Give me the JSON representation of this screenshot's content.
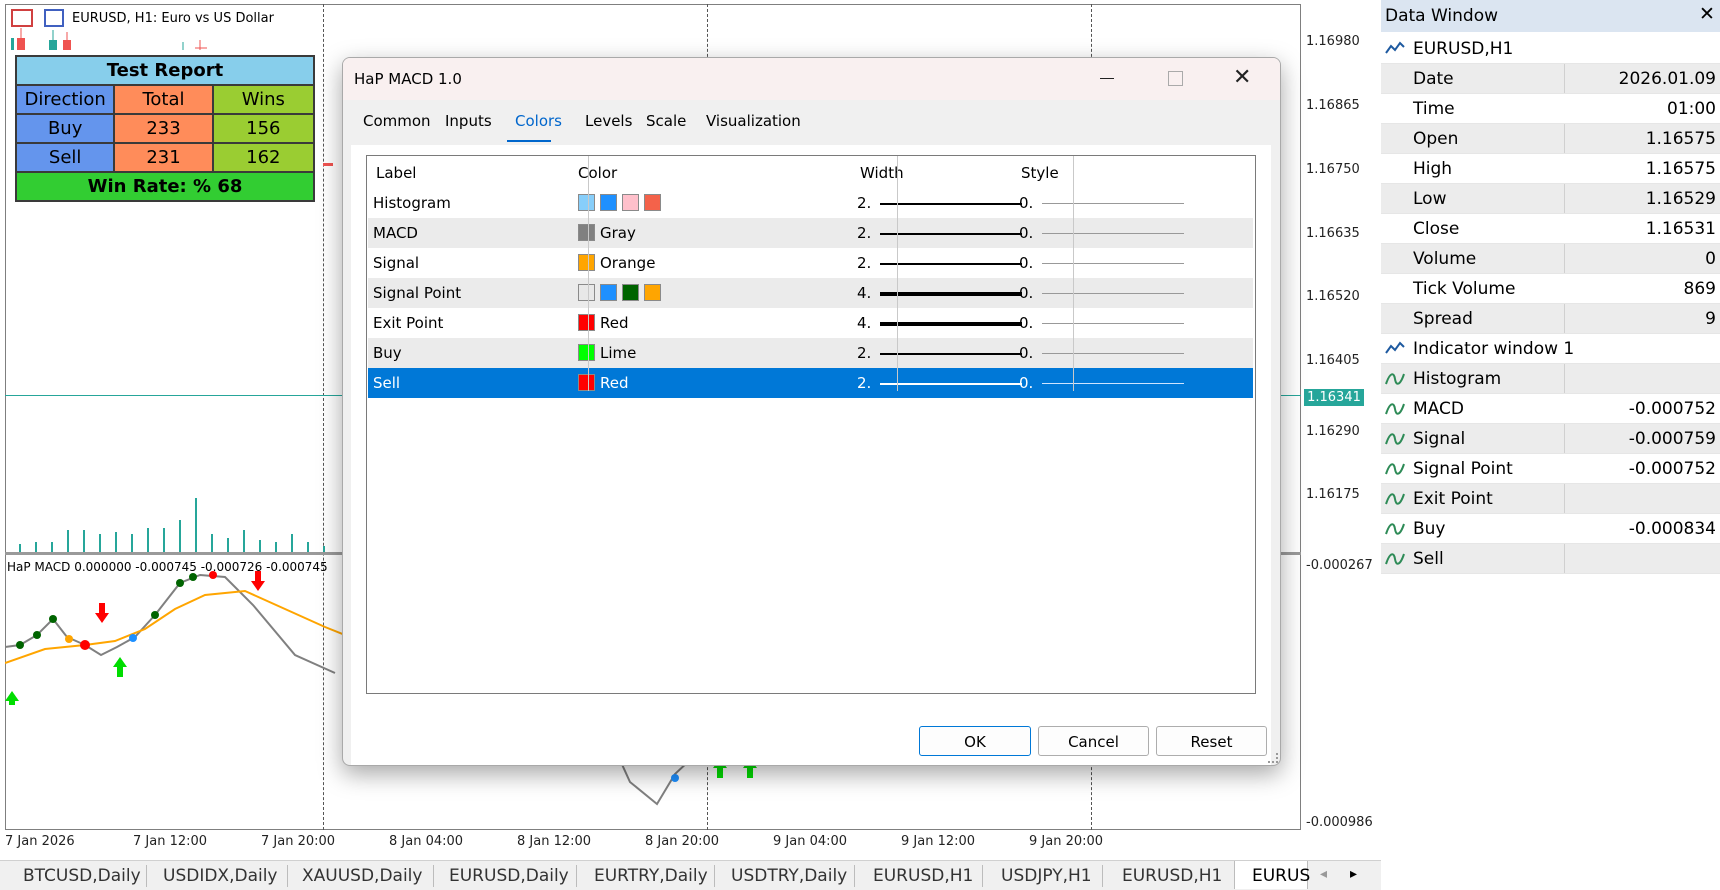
{
  "chart": {
    "title": "EURUSD, H1:  Euro vs US Dollar",
    "indicator_title": "HaP MACD 0.000000 -0.000745 -0.000726 -0.000745",
    "price_labels": [
      "1.16980",
      "1.16865",
      "1.16750",
      "1.16635",
      "1.16520",
      "1.16405",
      "1.16290",
      "1.16175",
      "-0.000267",
      "-0.000986"
    ],
    "current_price": "1.16341",
    "time_labels": [
      "7 Jan 2026",
      "7 Jan 12:00",
      "7 Jan 20:00",
      "8 Jan 04:00",
      "8 Jan 12:00",
      "8 Jan 20:00",
      "9 Jan 04:00",
      "9 Jan 12:00",
      "9 Jan 20:00"
    ],
    "colors": {
      "macd": "#808080",
      "signal": "#ffa500",
      "current_line": "#26a69a",
      "bull": "#26a69a",
      "bear": "#ef5350"
    }
  },
  "test_report": {
    "title": "Test Report",
    "headers": [
      "Direction",
      "Total",
      "Wins"
    ],
    "rows": [
      {
        "direction": "Buy",
        "total": "233",
        "wins": "156"
      },
      {
        "direction": "Sell",
        "total": "231",
        "wins": "162"
      }
    ],
    "win_rate_label": "Win Rate: %  68"
  },
  "dialog": {
    "title": "HaP MACD 1.0",
    "tabs": [
      "Common",
      "Inputs",
      "Colors",
      "Levels",
      "Scale",
      "Visualization"
    ],
    "active_tab": "Colors",
    "columns": [
      "Label",
      "Color",
      "Width",
      "Style"
    ],
    "rows": [
      {
        "label": "Histogram",
        "swatches": [
          "#87cefa",
          "#1e90ff",
          "#ffc0cb",
          "#f4624a"
        ],
        "color_name": "",
        "width": "2.",
        "style": "0."
      },
      {
        "label": "MACD",
        "swatches": [
          "#808080"
        ],
        "color_name": "Gray",
        "width": "2.",
        "style": "0."
      },
      {
        "label": "Signal",
        "swatches": [
          "#ffa500"
        ],
        "color_name": "Orange",
        "width": "2.",
        "style": "0."
      },
      {
        "label": "Signal Point",
        "swatches": [
          "#e8e8e8",
          "#1e90ff",
          "#006400",
          "#ffa500"
        ],
        "color_name": "",
        "width": "4.",
        "style": "0."
      },
      {
        "label": "Exit Point",
        "swatches": [
          "#ff0000"
        ],
        "color_name": "Red",
        "width": "4.",
        "style": "0."
      },
      {
        "label": "Buy",
        "swatches": [
          "#00ff00"
        ],
        "color_name": "Lime",
        "width": "2.",
        "style": "0."
      },
      {
        "label": "Sell",
        "swatches": [
          "#ff0000"
        ],
        "color_name": "Red",
        "width": "2.",
        "style": "0."
      }
    ],
    "selected_row": "Sell",
    "buttons": {
      "ok": "OK",
      "cancel": "Cancel",
      "reset": "Reset"
    }
  },
  "data_window": {
    "title": "Data Window",
    "symbol": "EURUSD,H1",
    "fields": [
      {
        "label": "Date",
        "value": "2026.01.09"
      },
      {
        "label": "Time",
        "value": "01:00"
      },
      {
        "label": "Open",
        "value": "1.16575"
      },
      {
        "label": "High",
        "value": "1.16575"
      },
      {
        "label": "Low",
        "value": "1.16529"
      },
      {
        "label": "Close",
        "value": "1.16531"
      },
      {
        "label": "Volume",
        "value": "0"
      },
      {
        "label": "Tick Volume",
        "value": "869"
      },
      {
        "label": "Spread",
        "value": "9"
      }
    ],
    "indicator_window": "Indicator window 1",
    "indicator_fields": [
      {
        "label": "Histogram",
        "value": ""
      },
      {
        "label": "MACD",
        "value": "-0.000752"
      },
      {
        "label": "Signal",
        "value": "-0.000759"
      },
      {
        "label": "Signal Point",
        "value": "-0.000752"
      },
      {
        "label": "Exit Point",
        "value": ""
      },
      {
        "label": "Buy",
        "value": "-0.000834"
      },
      {
        "label": "Sell",
        "value": ""
      }
    ]
  },
  "bottom_tabs": [
    "BTCUSD,Daily",
    "USDIDX,Daily",
    "XAUUSD,Daily",
    "EURUSD,Daily",
    "EURTRY,Daily",
    "USDTRY,Daily",
    "EURUSD,H1",
    "USDJPY,H1",
    "EURUSD,H1",
    "EURUS"
  ]
}
